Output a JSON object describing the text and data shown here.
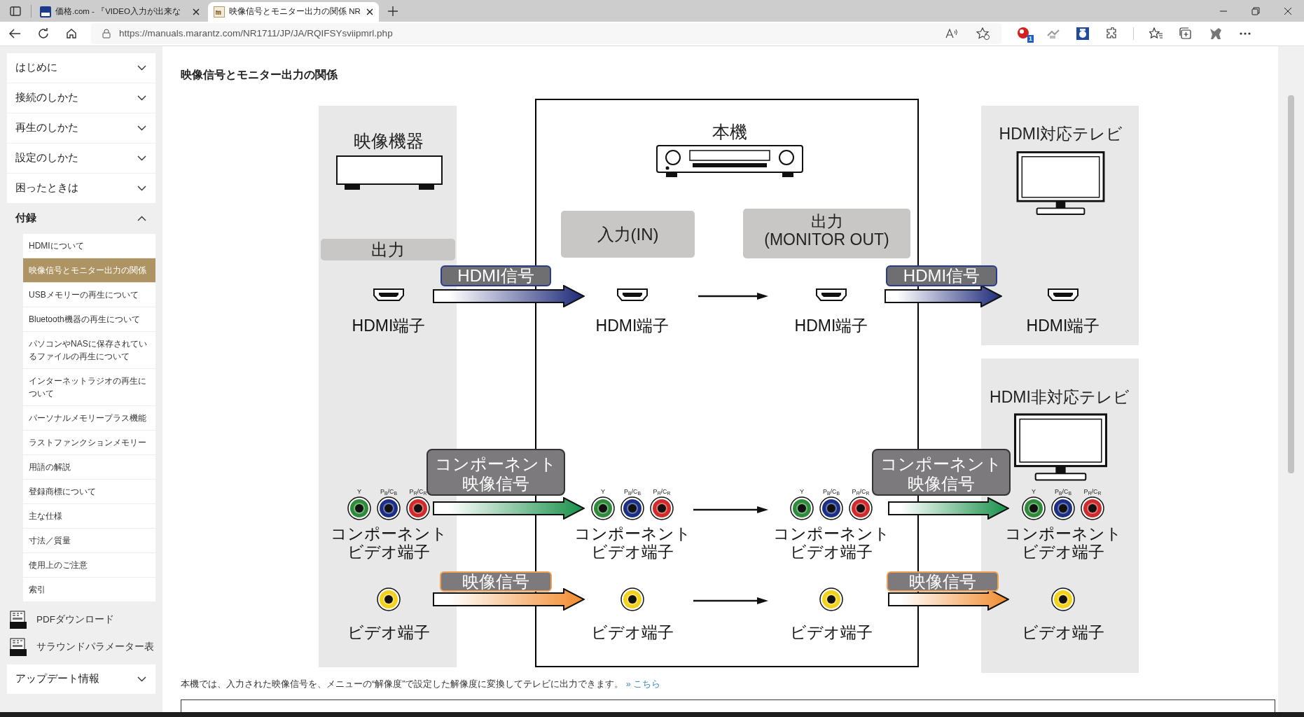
{
  "browser": {
    "tabs": [
      {
        "title": "価格.com - 『VIDEO入力が出来な",
        "selected": false
      },
      {
        "title": "映像信号とモニター出力の関係 NR",
        "selected": true
      }
    ],
    "url": "https://manuals.marantz.com/NR1711/JP/JA/RQIFSYsviipmrl.php",
    "extension_badge": "1"
  },
  "sidebar": {
    "sections": [
      {
        "label": "はじめに",
        "expanded": false
      },
      {
        "label": "接続のしかた",
        "expanded": false
      },
      {
        "label": "再生のしかた",
        "expanded": false
      },
      {
        "label": "設定のしかた",
        "expanded": false
      },
      {
        "label": "困ったときは",
        "expanded": false
      },
      {
        "label": "付録",
        "expanded": true,
        "children": [
          {
            "label": "HDMIについて",
            "selected": false
          },
          {
            "label": "映像信号とモニター出力の関係",
            "selected": true
          },
          {
            "label": "USBメモリーの再生について",
            "selected": false
          },
          {
            "label": "Bluetooth機器の再生について",
            "selected": false
          },
          {
            "label": "パソコンやNASに保存されているファイルの再生について",
            "selected": false
          },
          {
            "label": "インターネットラジオの再生について",
            "selected": false
          },
          {
            "label": "パーソナルメモリープラス機能",
            "selected": false
          },
          {
            "label": "ラストファンクションメモリー",
            "selected": false
          },
          {
            "label": "用語の解説",
            "selected": false
          },
          {
            "label": "登録商標について",
            "selected": false
          },
          {
            "label": "主な仕様",
            "selected": false
          },
          {
            "label": "寸法／質量",
            "selected": false
          },
          {
            "label": "使用上のご注意",
            "selected": false
          },
          {
            "label": "索引",
            "selected": false
          }
        ]
      }
    ],
    "downloads": [
      {
        "label": "PDFダウンロード"
      },
      {
        "label": "サラウンドパラメーター表"
      }
    ],
    "more_sections": [
      {
        "label": "アップデート情報",
        "expanded": false
      }
    ]
  },
  "page": {
    "title": "映像信号とモニター出力の関係",
    "diagram": {
      "source": {
        "title": "映像機器",
        "output_label": "出力"
      },
      "unit": {
        "title": "本機",
        "input_label": "入力(IN)",
        "output_label": [
          "出力",
          "(MONITOR OUT)"
        ]
      },
      "tv_hdmi": {
        "title": "HDMI対応テレビ"
      },
      "tv_analog": {
        "title": "HDMI非対応テレビ"
      },
      "rows": [
        {
          "kind": "hdmi",
          "signals": [
            [
              "HDMI信号"
            ],
            [
              "HDMI信号"
            ]
          ],
          "ports": [
            {
              "label": [
                "HDMI端子"
              ]
            },
            {
              "label": [
                "HDMI端子"
              ]
            },
            {
              "label": [
                "HDMI端子"
              ]
            },
            {
              "label": [
                "HDMI端子"
              ]
            }
          ]
        },
        {
          "kind": "component",
          "signals": [
            [
              "コンポーネント",
              "映像信号"
            ],
            [
              "コンポーネント",
              "映像信号"
            ]
          ],
          "ports": [
            {
              "label": [
                "コンポーネント",
                "ビデオ端子"
              ],
              "jacks": [
                {
                  "label": "Y",
                  "color": "#2e8b3a"
                },
                {
                  "label": "P$_{B}$/C$_{B}$",
                  "color": "#1c2f86"
                },
                {
                  "label": "P$_{R}$/C$_{R}$",
                  "color": "#d02a2a"
                }
              ]
            },
            {
              "label": [
                "コンポーネント",
                "ビデオ端子"
              ],
              "jacks": [
                {
                  "label": "Y",
                  "color": "#2e8b3a"
                },
                {
                  "label": "P$_{B}$/C$_{B}$",
                  "color": "#1c2f86"
                },
                {
                  "label": "P$_{R}$/C$_{R}$",
                  "color": "#d02a2a"
                }
              ]
            },
            {
              "label": [
                "コンポーネント",
                "ビデオ端子"
              ],
              "jacks": [
                {
                  "label": "Y",
                  "color": "#2e8b3a"
                },
                {
                  "label": "P$_{B}$/C$_{B}$",
                  "color": "#1c2f86"
                },
                {
                  "label": "P$_{R}$/C$_{R}$",
                  "color": "#d02a2a"
                }
              ]
            },
            {
              "label": [
                "コンポーネント",
                "ビデオ端子"
              ],
              "jacks": [
                {
                  "label": "Y",
                  "color": "#2e8b3a"
                },
                {
                  "label": "P$_{B}$/C$_{B}$",
                  "color": "#1c2f86"
                },
                {
                  "label": "P$_{R}$/C$_{R}$",
                  "color": "#d02a2a"
                }
              ]
            }
          ]
        },
        {
          "kind": "video",
          "signals": [
            [
              "映像信号"
            ],
            [
              "映像信号"
            ]
          ],
          "ports": [
            {
              "label": [
                "ビデオ端子"
              ],
              "jacks": [
                {
                  "color": "#f2d21a"
                }
              ]
            },
            {
              "label": [
                "ビデオ端子"
              ],
              "jacks": [
                {
                  "color": "#f2d21a"
                }
              ]
            },
            {
              "label": [
                "ビデオ端子"
              ],
              "jacks": [
                {
                  "color": "#f2d21a"
                }
              ]
            },
            {
              "label": [
                "ビデオ端子"
              ],
              "jacks": [
                {
                  "color": "#f2d21a"
                }
              ]
            }
          ]
        }
      ]
    },
    "note": "本機では、入力された映像信号を、メニューの“解像度”で設定した解像度に変換してテレビに出力できます。",
    "note_link": "» こちら"
  }
}
